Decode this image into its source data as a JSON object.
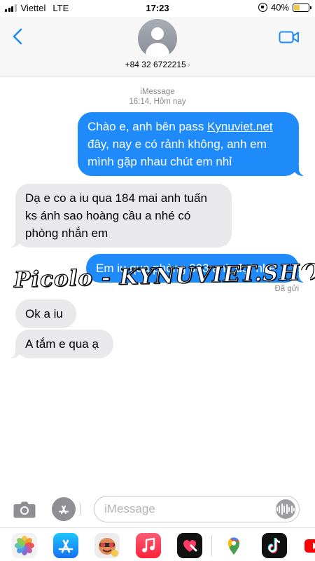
{
  "status_bar": {
    "carrier": "Viettel",
    "network": "LTE",
    "time": "17:23",
    "battery": "40%",
    "battery_level": 0.4
  },
  "header": {
    "contact": "+84 32 6722215",
    "back_icon": "chevron-left-icon",
    "video_icon": "video-camera-icon",
    "accent_color": "#1f8bfa"
  },
  "thread": {
    "service": "iMessage",
    "timestamp": "16:14, Hôm nay",
    "messages": [
      {
        "direction": "outgoing",
        "text_before": "Chào e, anh bên pass ",
        "link": "Kynuviet.net",
        "text_after": " đây, nay e có rảnh không, anh em mình gặp nhau chút em nhỉ"
      },
      {
        "direction": "incoming",
        "text": "Dạ e co a iu qua 184 mai anh tuấn ks ánh sao hoàng cầu a nhé có phòng nhắn em"
      },
      {
        "direction": "outgoing",
        "text": "Em iu qua phòng 303 anh đợi nhé"
      },
      {
        "direction": "incoming",
        "text": "Ok a iu"
      },
      {
        "direction": "incoming",
        "text": "A tắm e qua ạ"
      }
    ],
    "delivered": "Đã gửi"
  },
  "watermark": "Picolo - KYNUVIET.SHOW",
  "composer": {
    "placeholder": "iMessage",
    "camera_icon": "camera-icon",
    "apps_icon": "app-store-icon",
    "audio_icon": "audio-waveform-icon"
  },
  "app_drawer": [
    "photos-icon",
    "app-store-icon",
    "memoji-icon",
    "music-icon",
    "digital-touch-icon",
    "google-maps-icon",
    "tiktok-icon",
    "youtube-icon"
  ]
}
